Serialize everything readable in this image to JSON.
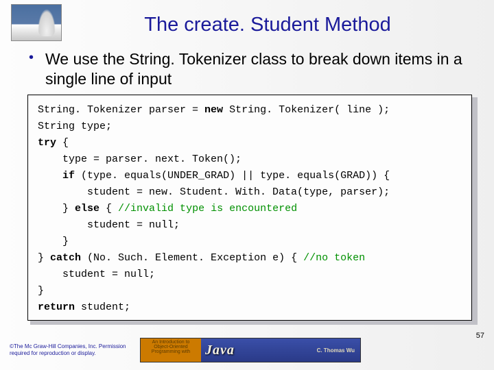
{
  "title": "The create. Student Method",
  "bullet": "We use the String. Tokenizer class to break down items in a single line of input",
  "code": {
    "l1a": "String. Tokenizer parser = ",
    "l1kw": "new",
    "l1b": " String. Tokenizer( line );",
    "l2": "String type;",
    "l3kw": "try",
    "l3b": " {",
    "l4": "    type = parser. next. Token();",
    "l5a": "    ",
    "l5kw": "if",
    "l5b": " (type. equals(UNDER_GRAD) || type. equals(GRAD)) {",
    "l6": "        student = new. Student. With. Data(type, parser);",
    "l7a": "    } ",
    "l7kw": "else",
    "l7b": " { ",
    "l7cm": "//invalid type is encountered",
    "l8": "        student = null;",
    "l9": "    }",
    "l10a": "} ",
    "l10kw": "catch",
    "l10b": " (No. Such. Element. Exception e) { ",
    "l10cm": "//no token",
    "l11": "    student = null;",
    "l12": "}",
    "l13kw": "return",
    "l13b": " student;"
  },
  "copyright": "©The Mc Graw-Hill Companies, Inc. Permission required for reproduction or display.",
  "banner": {
    "intro1": "An Introduction to",
    "intro2": "Object-Oriented",
    "intro3": "Programming with",
    "java": "Java",
    "author": "C. Thomas Wu"
  },
  "pagenum": "57"
}
